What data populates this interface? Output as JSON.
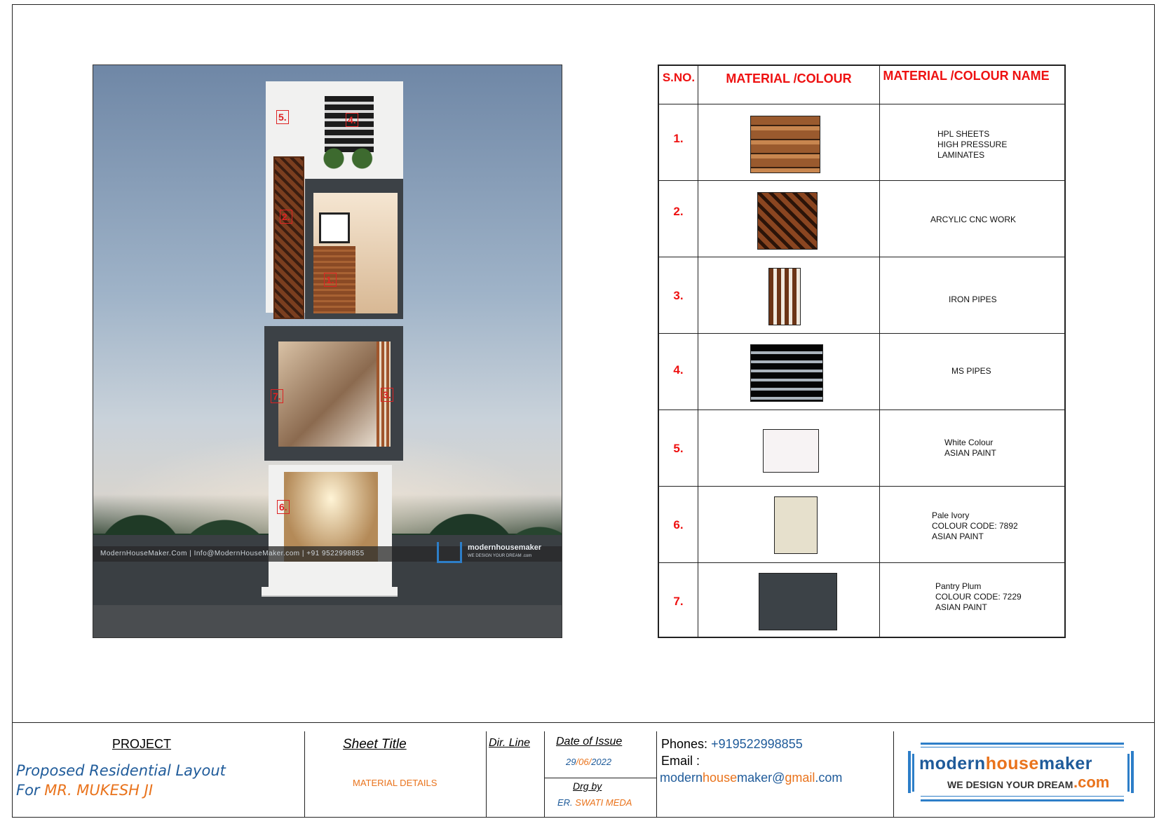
{
  "render": {
    "markers": [
      "5.",
      "4.",
      "2.",
      "1.",
      "7.",
      "3.",
      "6."
    ],
    "watermark": "ModernHouseMaker.Com   |   Info@ModernHouseMaker.com   |   +91 9522998855",
    "watermark_logo": "modernhousemaker",
    "watermark_logo_sub": "WE DESIGN YOUR DREAM .com"
  },
  "table": {
    "headers": [
      "S.NO.",
      "MATERIAL /COLOUR",
      "MATERIAL /COLOUR NAME"
    ],
    "rows": [
      {
        "sno": "1.",
        "name_lines": [
          "HPL SHEETS",
          "HIGH PRESSURE",
          "LAMINATES"
        ],
        "swatch": "wood-stripes"
      },
      {
        "sno": "2.",
        "name_lines": [
          "ARCYLIC CNC WORK"
        ],
        "swatch": "cnc-pattern"
      },
      {
        "sno": "3.",
        "name_lines": [
          "IRON PIPES"
        ],
        "swatch": "vertical-pipes"
      },
      {
        "sno": "4.",
        "name_lines": [
          "MS PIPES"
        ],
        "swatch": "horizontal-pipes"
      },
      {
        "sno": "5.",
        "name_lines": [
          "White Colour",
          "ASIAN PAINT"
        ],
        "swatch": "white"
      },
      {
        "sno": "6.",
        "name_lines": [
          "Pale Ivory",
          "COLOUR CODE: 7892",
          "ASIAN PAINT"
        ],
        "swatch": "pale-ivory"
      },
      {
        "sno": "7.",
        "name_lines": [
          "Pantry Plum",
          "COLOUR CODE: 7229",
          "ASIAN PAINT"
        ],
        "swatch": "pantry-plum"
      }
    ]
  },
  "title_block": {
    "project_label": "PROJECT",
    "project_line1": "Proposed Residential Layout",
    "project_for": "For ",
    "project_client": "MR. MUKESH JI",
    "sheet_title_label": "Sheet Title",
    "sheet_title": "MATERIAL DETAILS",
    "dir_line_label": "Dir. Line",
    "date_label": "Date of Issue",
    "date_dd": "29",
    "date_mm": "06",
    "date_yyyy": "2022",
    "drg_by_label": "Drg by",
    "drg_by_prefix": "ER. ",
    "drg_by_name": "SWATI MEDA",
    "phones_label": "Phones:",
    "phones_value": "+919522998855",
    "email_label": "Email :",
    "email_a": "modern",
    "email_b": "house",
    "email_c": "maker@",
    "email_d": "gmail",
    "email_e": ".com",
    "logo_a": "modern",
    "logo_b": "house",
    "logo_c": "maker",
    "logo_tagline": "WE DESIGN YOUR DREAM",
    "logo_com": ".com"
  },
  "colors": {
    "accent_red": "#e11",
    "accent_blue": "#1f5b9a",
    "accent_orange": "#e9731c",
    "white_colour": "#f7f3f4",
    "pale_ivory": "#e6e0cc",
    "pantry_plum": "#3c4247"
  }
}
